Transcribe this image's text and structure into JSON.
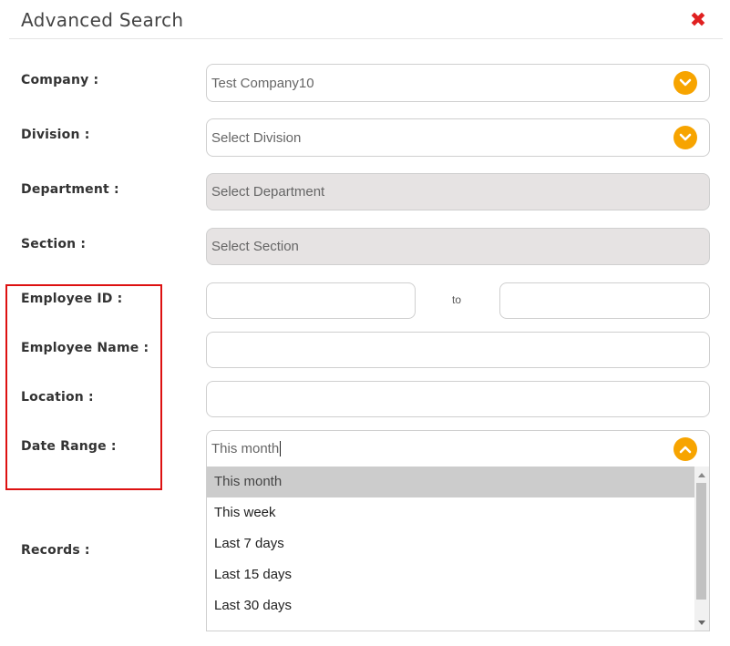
{
  "dialog": {
    "title": "Advanced Search",
    "close_icon": "close-icon"
  },
  "fields": {
    "company": {
      "label": "Company :",
      "value": "Test Company10"
    },
    "division": {
      "label": "Division :",
      "placeholder": "Select Division"
    },
    "department": {
      "label": "Department :",
      "placeholder": "Select Department"
    },
    "section": {
      "label": "Section :",
      "placeholder": "Select Section"
    },
    "employee_id": {
      "label": "Employee ID :",
      "to": "to"
    },
    "employee_name": {
      "label": "Employee Name :"
    },
    "location": {
      "label": "Location :"
    },
    "date_range": {
      "label": "Date Range :",
      "value": "This month"
    },
    "records": {
      "label": "Records :"
    }
  },
  "date_range_options": [
    "This month",
    "This week",
    "Last 7 days",
    "Last 15 days",
    "Last 30 days"
  ],
  "selected_option_index": 0,
  "colors": {
    "accent": "#f7a400",
    "close": "#e02020",
    "highlight_box": "#dd1111",
    "disabled_bg": "#e6e3e3"
  }
}
